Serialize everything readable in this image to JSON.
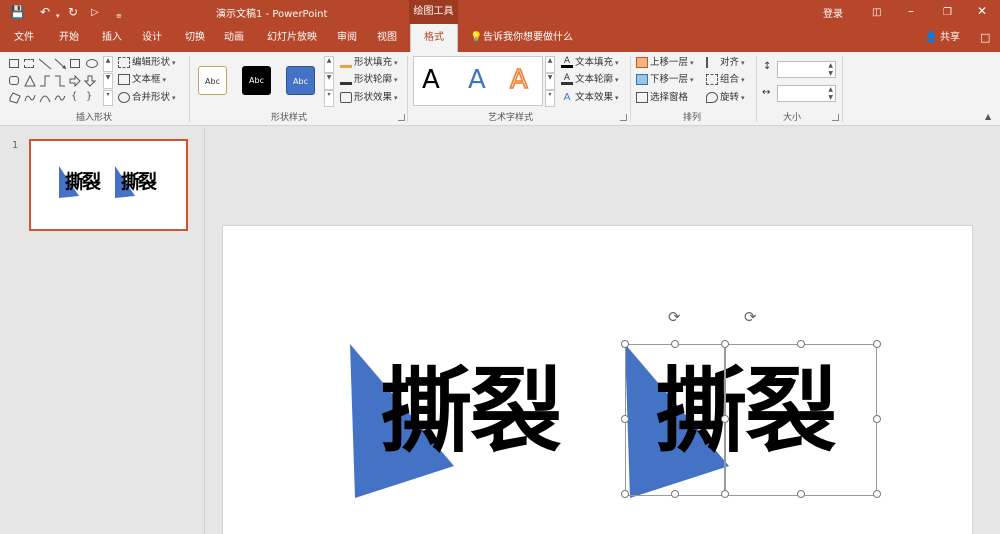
{
  "titlebar": {
    "title": "演示文稿1 - PowerPoint",
    "context_tab": "绘图工具",
    "login": "登录",
    "colors": {
      "brand": "#b7472a",
      "ribbon": "#f3f3f3"
    }
  },
  "tabs": [
    "文件",
    "开始",
    "插入",
    "设计",
    "切换",
    "动画",
    "幻灯片放映",
    "审阅",
    "视图",
    "格式"
  ],
  "active_tab": "格式",
  "tell_me": "告诉我你想要做什么",
  "share": "共享",
  "ribbon": {
    "insert_shapes": {
      "label": "插入形状",
      "edit_shape": "编辑形状",
      "text_box": "文本框",
      "merge_shapes": "合并形状"
    },
    "shape_styles": {
      "label": "形状样式",
      "samples": [
        "Abc",
        "Abc",
        "Abc"
      ],
      "fill": "形状填充",
      "outline": "形状轮廓",
      "effects": "形状效果"
    },
    "wordart": {
      "label": "艺术字样式",
      "samples": [
        "A",
        "A",
        "A"
      ],
      "text_fill": "文本填充",
      "text_outline": "文本轮廓",
      "text_effects": "文本效果"
    },
    "arrange": {
      "label": "排列",
      "bring_forward": "上移一层",
      "send_backward": "下移一层",
      "selection_pane": "选择窗格",
      "align": "对齐",
      "group": "组合",
      "rotate": "旋转"
    },
    "size": {
      "label": "大小",
      "height_value": "",
      "width_value": ""
    }
  },
  "thumbnail": {
    "number": "1",
    "text": "撕裂"
  },
  "slide": {
    "left_text": "撕裂",
    "right_text": "撕裂",
    "triangle_color": "#4472c4"
  }
}
